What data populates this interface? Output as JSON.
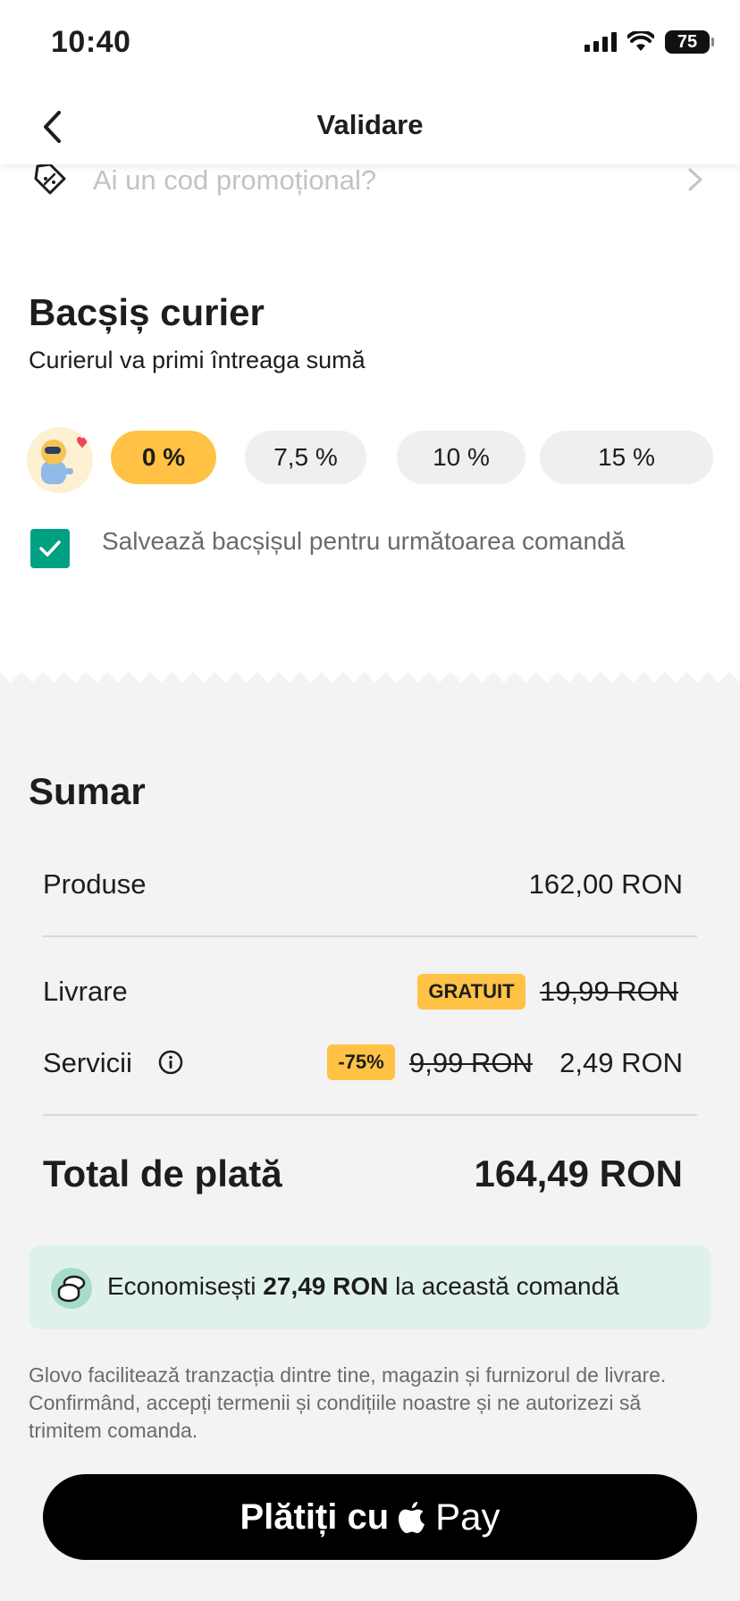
{
  "status_bar": {
    "time": "10:40",
    "battery": "75"
  },
  "header": {
    "title": "Validare"
  },
  "promo": {
    "placeholder": "Ai un cod promoțional?"
  },
  "tip": {
    "title": "Bacșiș curier",
    "subtitle": "Curierul va primi întreaga sumă",
    "options": [
      "0 %",
      "7,5 %",
      "10 %",
      "15 %"
    ],
    "selected": "0 %",
    "save_label": "Salvează bacșișul pentru următoarea comandă",
    "save_checked": true
  },
  "summary": {
    "title": "Sumar",
    "products_label": "Produse",
    "products_value": "162,00 RON",
    "delivery_label": "Livrare",
    "delivery_badge": "GRATUIT",
    "delivery_old": "19,99 RON",
    "services_label": "Servicii",
    "services_badge": "-75%",
    "services_old": "9,99 RON",
    "services_value": "2,49 RON",
    "total_label": "Total de plată",
    "total_value": "164,49 RON"
  },
  "savings": {
    "prefix": "Economisești",
    "amount": "27,49 RON",
    "suffix": "la această comandă"
  },
  "legal": "Glovo facilitează tranzacția dintre tine, magazin și furnizorul de livrare. Confirmând, accepți termenii și condițiile noastre și ne autorizezi să trimitem comanda.",
  "pay_button": {
    "label": "Plătiți cu",
    "brand": "Pay"
  },
  "colors": {
    "accent_yellow": "#ffc244",
    "accent_green": "#00a082",
    "savings_bg": "#e0f1ec"
  },
  "icons": [
    "back-arrow-icon",
    "promo-tag-icon",
    "chevron-right-icon",
    "courier-avatar",
    "checkmark-icon",
    "info-icon",
    "coins-icon",
    "apple-logo-icon"
  ]
}
